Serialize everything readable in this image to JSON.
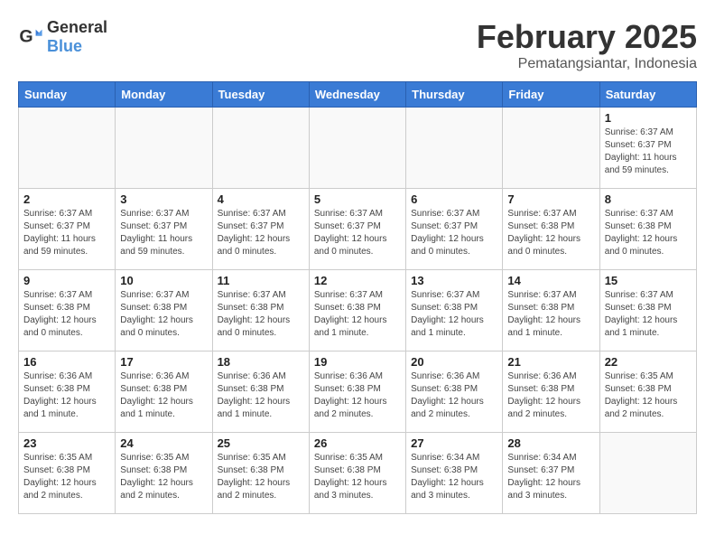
{
  "logo": {
    "general": "General",
    "blue": "Blue"
  },
  "title": "February 2025",
  "location": "Pematangsiantar, Indonesia",
  "days_of_week": [
    "Sunday",
    "Monday",
    "Tuesday",
    "Wednesday",
    "Thursday",
    "Friday",
    "Saturday"
  ],
  "weeks": [
    [
      {
        "day": "",
        "info": ""
      },
      {
        "day": "",
        "info": ""
      },
      {
        "day": "",
        "info": ""
      },
      {
        "day": "",
        "info": ""
      },
      {
        "day": "",
        "info": ""
      },
      {
        "day": "",
        "info": ""
      },
      {
        "day": "1",
        "info": "Sunrise: 6:37 AM\nSunset: 6:37 PM\nDaylight: 11 hours and 59 minutes."
      }
    ],
    [
      {
        "day": "2",
        "info": "Sunrise: 6:37 AM\nSunset: 6:37 PM\nDaylight: 11 hours and 59 minutes."
      },
      {
        "day": "3",
        "info": "Sunrise: 6:37 AM\nSunset: 6:37 PM\nDaylight: 11 hours and 59 minutes."
      },
      {
        "day": "4",
        "info": "Sunrise: 6:37 AM\nSunset: 6:37 PM\nDaylight: 12 hours and 0 minutes."
      },
      {
        "day": "5",
        "info": "Sunrise: 6:37 AM\nSunset: 6:37 PM\nDaylight: 12 hours and 0 minutes."
      },
      {
        "day": "6",
        "info": "Sunrise: 6:37 AM\nSunset: 6:37 PM\nDaylight: 12 hours and 0 minutes."
      },
      {
        "day": "7",
        "info": "Sunrise: 6:37 AM\nSunset: 6:38 PM\nDaylight: 12 hours and 0 minutes."
      },
      {
        "day": "8",
        "info": "Sunrise: 6:37 AM\nSunset: 6:38 PM\nDaylight: 12 hours and 0 minutes."
      }
    ],
    [
      {
        "day": "9",
        "info": "Sunrise: 6:37 AM\nSunset: 6:38 PM\nDaylight: 12 hours and 0 minutes."
      },
      {
        "day": "10",
        "info": "Sunrise: 6:37 AM\nSunset: 6:38 PM\nDaylight: 12 hours and 0 minutes."
      },
      {
        "day": "11",
        "info": "Sunrise: 6:37 AM\nSunset: 6:38 PM\nDaylight: 12 hours and 0 minutes."
      },
      {
        "day": "12",
        "info": "Sunrise: 6:37 AM\nSunset: 6:38 PM\nDaylight: 12 hours and 1 minute."
      },
      {
        "day": "13",
        "info": "Sunrise: 6:37 AM\nSunset: 6:38 PM\nDaylight: 12 hours and 1 minute."
      },
      {
        "day": "14",
        "info": "Sunrise: 6:37 AM\nSunset: 6:38 PM\nDaylight: 12 hours and 1 minute."
      },
      {
        "day": "15",
        "info": "Sunrise: 6:37 AM\nSunset: 6:38 PM\nDaylight: 12 hours and 1 minute."
      }
    ],
    [
      {
        "day": "16",
        "info": "Sunrise: 6:36 AM\nSunset: 6:38 PM\nDaylight: 12 hours and 1 minute."
      },
      {
        "day": "17",
        "info": "Sunrise: 6:36 AM\nSunset: 6:38 PM\nDaylight: 12 hours and 1 minute."
      },
      {
        "day": "18",
        "info": "Sunrise: 6:36 AM\nSunset: 6:38 PM\nDaylight: 12 hours and 1 minute."
      },
      {
        "day": "19",
        "info": "Sunrise: 6:36 AM\nSunset: 6:38 PM\nDaylight: 12 hours and 2 minutes."
      },
      {
        "day": "20",
        "info": "Sunrise: 6:36 AM\nSunset: 6:38 PM\nDaylight: 12 hours and 2 minutes."
      },
      {
        "day": "21",
        "info": "Sunrise: 6:36 AM\nSunset: 6:38 PM\nDaylight: 12 hours and 2 minutes."
      },
      {
        "day": "22",
        "info": "Sunrise: 6:35 AM\nSunset: 6:38 PM\nDaylight: 12 hours and 2 minutes."
      }
    ],
    [
      {
        "day": "23",
        "info": "Sunrise: 6:35 AM\nSunset: 6:38 PM\nDaylight: 12 hours and 2 minutes."
      },
      {
        "day": "24",
        "info": "Sunrise: 6:35 AM\nSunset: 6:38 PM\nDaylight: 12 hours and 2 minutes."
      },
      {
        "day": "25",
        "info": "Sunrise: 6:35 AM\nSunset: 6:38 PM\nDaylight: 12 hours and 2 minutes."
      },
      {
        "day": "26",
        "info": "Sunrise: 6:35 AM\nSunset: 6:38 PM\nDaylight: 12 hours and 3 minutes."
      },
      {
        "day": "27",
        "info": "Sunrise: 6:34 AM\nSunset: 6:38 PM\nDaylight: 12 hours and 3 minutes."
      },
      {
        "day": "28",
        "info": "Sunrise: 6:34 AM\nSunset: 6:37 PM\nDaylight: 12 hours and 3 minutes."
      },
      {
        "day": "",
        "info": ""
      }
    ]
  ]
}
